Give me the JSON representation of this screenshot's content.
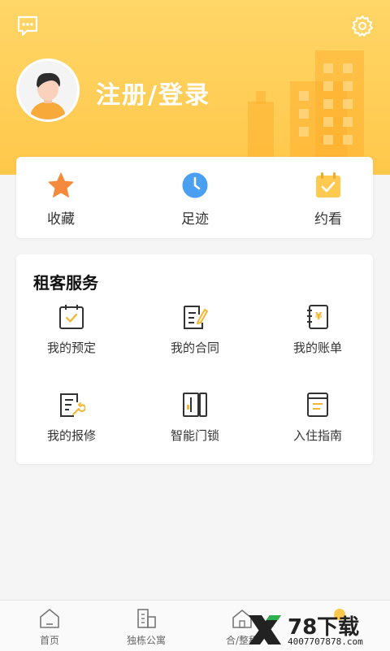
{
  "header": {
    "login_label": "注册/登录",
    "bg_color": "#ffc84a"
  },
  "quick_actions": [
    {
      "label": "收藏",
      "icon": "star-icon",
      "color": "#f58a3c"
    },
    {
      "label": "足迹",
      "icon": "clock-icon",
      "color": "#4a9ff0"
    },
    {
      "label": "约看",
      "icon": "calendar-check-icon",
      "color": "#ffc84a"
    }
  ],
  "services": {
    "title": "租客服务",
    "items": [
      {
        "label": "我的预定",
        "icon": "calendar-check-icon"
      },
      {
        "label": "我的合同",
        "icon": "contract-icon"
      },
      {
        "label": "我的账单",
        "icon": "bill-icon"
      },
      {
        "label": "我的报修",
        "icon": "repair-icon"
      },
      {
        "label": "智能门锁",
        "icon": "door-lock-icon"
      },
      {
        "label": "入住指南",
        "icon": "guide-book-icon"
      }
    ]
  },
  "bottom_nav": [
    {
      "label": "首页",
      "icon": "home-icon"
    },
    {
      "label": "独栋公寓",
      "icon": "building-icon"
    },
    {
      "label": "合/整租",
      "icon": "house-icon"
    }
  ],
  "watermark": {
    "text": "78下载",
    "url": "4007707878.com"
  }
}
